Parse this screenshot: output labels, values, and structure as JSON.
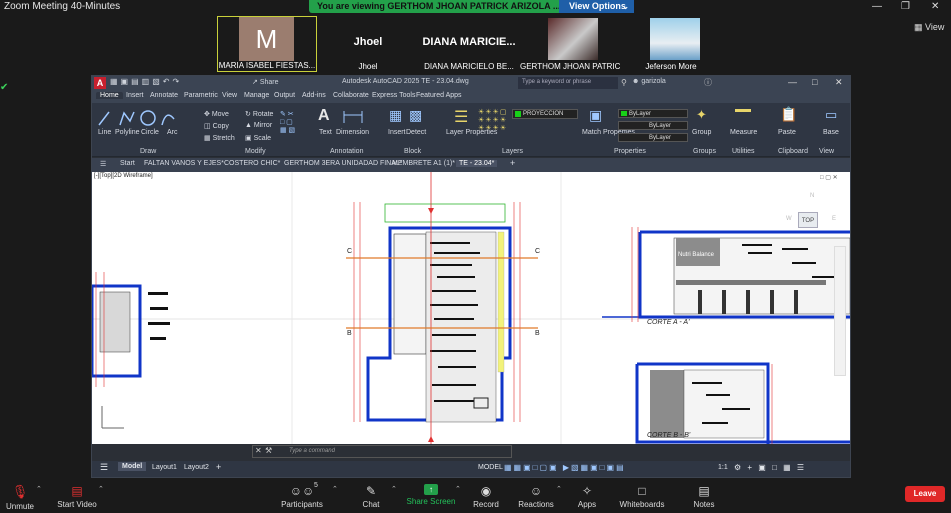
{
  "zoom": {
    "window_title": "Zoom Meeting 40-Minutes",
    "banner_text": "You are viewing GERTHOM JHOAN PATRICK ARIZOLA ...'s screen",
    "view_options_label": "View Options",
    "view_label": "View",
    "participants": [
      {
        "name": "MARIA ISABEL FIESTAS...",
        "initial": "M"
      },
      {
        "name": "Jhoel",
        "big": "Jhoel"
      },
      {
        "name": "DIANA MARICIELO BE...",
        "big": "DIANA MARICIE..."
      },
      {
        "name": "GERTHOM JHOAN PATRIC..."
      },
      {
        "name": "Jeferson More"
      }
    ],
    "toolbar": {
      "unmute": "Unmute",
      "start_video": "Start Video",
      "participants": "Participants",
      "participants_count": "5",
      "chat": "Chat",
      "share": "Share Screen",
      "record": "Record",
      "reactions": "Reactions",
      "apps": "Apps",
      "whiteboards": "Whiteboards",
      "notes": "Notes",
      "leave": "Leave"
    }
  },
  "acad": {
    "title": "Autodesk AutoCAD 2025    TE - 23.04.dwg",
    "share": "Share",
    "search_placeholder": "Type a keyword or phrase",
    "user": "garizola",
    "ribbon_tabs": [
      "Home",
      "Insert",
      "Annotate",
      "Parametric",
      "View",
      "Manage",
      "Output",
      "Add-ins",
      "Collaborate",
      "Express Tools",
      "Featured Apps"
    ],
    "draw_tools": [
      "Line",
      "Polyline",
      "Circle",
      "Arc"
    ],
    "modify_tools": [
      "Move",
      "Rotate",
      "Copy",
      "Mirror",
      "Stretch",
      "Scale"
    ],
    "annotation_tools": [
      "Text",
      "Dimension"
    ],
    "block_tools": [
      "Insert",
      "Detect"
    ],
    "layer_props": "Layer Properties",
    "layer_name": "PROYECCION",
    "match_props": "Match Properties",
    "bylayer": "ByLayer",
    "groups_tools": [
      "Group",
      "Measure",
      "Paste",
      "Base"
    ],
    "groups": [
      "Draw",
      "Modify",
      "Annotation",
      "Block",
      "Layers",
      "Properties",
      "Groups",
      "Utilities",
      "Clipboard",
      "View"
    ],
    "file_tabs": [
      "Start",
      "FALTAN VANOS Y EJES*",
      "COSTERO CHIC*",
      "GERTHOM 3ERA UNIDADAD FINAL*",
      "MEMBRETE A1 (1)*",
      "TE - 23.04*"
    ],
    "viewport_label": "[-][Top][2D Wireframe]",
    "viewcube": {
      "top": "TOP",
      "n": "N",
      "w": "W",
      "e": "E"
    },
    "drawing": {
      "section_1": "CORTE  A - A'",
      "section_2": "CORTE  B - B'",
      "cut_c": "C",
      "cut_b": "B",
      "store_sign": "Nutri Balance"
    },
    "command_placeholder": "Type a command",
    "layout_tabs": [
      "Model",
      "Layout1",
      "Layout2"
    ],
    "status_model": "MODEL",
    "status_scale": "1:1"
  }
}
